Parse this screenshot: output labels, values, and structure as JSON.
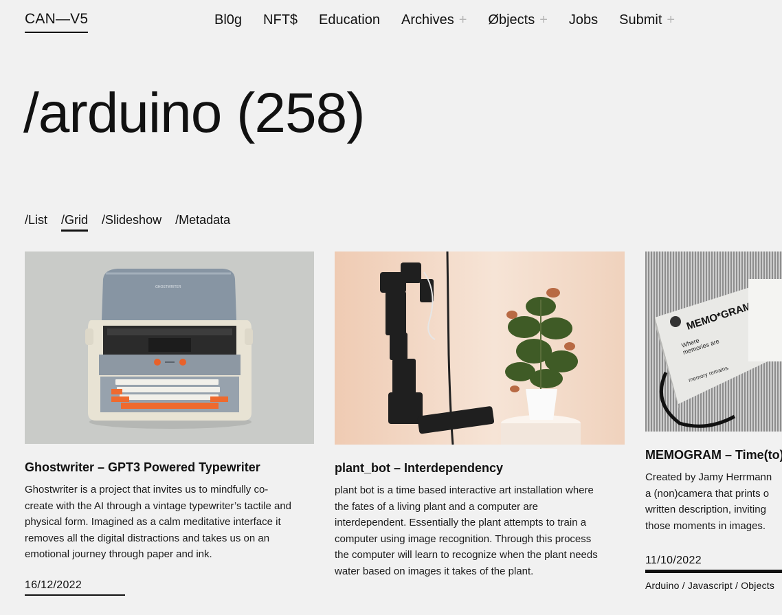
{
  "header": {
    "logo": "CAN—V5",
    "nav": [
      {
        "label": "Bl0g",
        "has_plus": false
      },
      {
        "label": "NFT$",
        "has_plus": false
      },
      {
        "label": "Education",
        "has_plus": false
      },
      {
        "label": "Archives",
        "has_plus": true
      },
      {
        "label": "Øbjects",
        "has_plus": true
      },
      {
        "label": "Jobs",
        "has_plus": false
      },
      {
        "label": "Submit",
        "has_plus": true
      }
    ],
    "plus_symbol": "+"
  },
  "page_title": "/arduino (258)",
  "views": {
    "list": "/List",
    "grid": "/Grid",
    "slideshow": "/Slideshow",
    "metadata": "/Metadata",
    "active": "grid"
  },
  "cards": [
    {
      "title": "Ghostwriter – GPT3 Powered Typewriter",
      "description": "Ghostwriter is a project that invites us to mindfully co-create with the AI through a vintage typewriter’s tactile and physical form. Imagined as a calm meditative interface it removes all the digital distractions and takes us on an emotional journey through paper and ink.",
      "date": "16/12/2022",
      "image_label": "GHOSTWRITER"
    },
    {
      "title": "plant_bot – Interdependency",
      "description": "plant bot is a time based interactive art installation where the fates of a living plant and a computer are interdependent. Essentially the plant attempts to train a computer using image recognition. Through this process the computer will learn to recognize when the plant needs water based on images it takes of the plant."
    },
    {
      "title": "MEMOGRAM – Time(to)",
      "description_lines": [
        "Created by Jamy Herrmann",
        "a (non)camera that prints o",
        "written description, inviting",
        "those moments in images."
      ],
      "date": "11/10/2022",
      "tags": "Arduino / Javascript / Objects",
      "image_text": {
        "brand": "MEMO*GRAM",
        "line1": "Where",
        "line2": "memories are",
        "line3": "memory remains."
      }
    }
  ],
  "colors": {
    "background": "#f1f1f1",
    "text": "#111111",
    "plus": "#b5b5b5"
  }
}
